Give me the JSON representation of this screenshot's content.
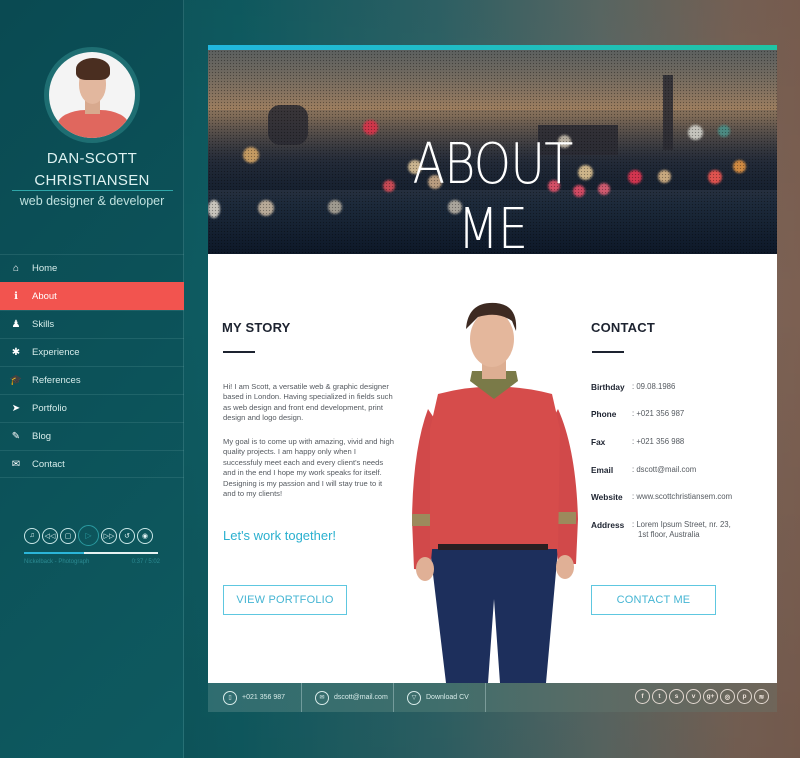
{
  "profile": {
    "name_line1": "DAN-SCOTT",
    "name_line2": "CHRISTIANSEN",
    "role": "web designer & developer"
  },
  "sidebar": {
    "items": [
      {
        "label": "Home",
        "icon": "home-icon",
        "glyph": "⌂",
        "active": false
      },
      {
        "label": "About",
        "icon": "info-icon",
        "glyph": "ℹ",
        "active": true
      },
      {
        "label": "Skills",
        "icon": "user-check-icon",
        "glyph": "♟",
        "active": false
      },
      {
        "label": "Experience",
        "icon": "gear-icon",
        "glyph": "✱",
        "active": false
      },
      {
        "label": "References",
        "icon": "graduation-cap-icon",
        "glyph": "🎓",
        "active": false
      },
      {
        "label": "Portfolio",
        "icon": "paper-plane-icon",
        "glyph": "➤",
        "active": false
      },
      {
        "label": "Blog",
        "icon": "quill-icon",
        "glyph": "✎",
        "active": false
      },
      {
        "label": "Contact",
        "icon": "envelope-icon",
        "glyph": "✉",
        "active": false
      }
    ]
  },
  "player": {
    "controls": [
      {
        "name": "music-icon",
        "glyph": "♫"
      },
      {
        "name": "rewind-icon",
        "glyph": "◁◁"
      },
      {
        "name": "stop-icon",
        "glyph": "▢"
      },
      {
        "name": "play-icon",
        "glyph": "▷"
      },
      {
        "name": "forward-icon",
        "glyph": "▷▷"
      },
      {
        "name": "repeat-icon",
        "glyph": "↺"
      },
      {
        "name": "volume-icon",
        "glyph": "◉"
      }
    ],
    "track": "Nickelback - Photograph",
    "time": "0:37 / 5:02",
    "progress": 0.45
  },
  "hero": {
    "title": "ABOUT ME"
  },
  "story": {
    "title": "MY STORY",
    "paragraph1": "Hi! I am Scott, a versatile web & graphic designer based in London. Having specialized in fields such as web design and front end development, print design and logo design.",
    "paragraph2": "My goal is to come up with amazing, vivid and high quality projects. I am happy only  when I successfuly meet each and every client's needs and in the end I hope my work speaks for itself. Designing is my passion and I will stay true to it and to my clients!",
    "tagline": "Let's work together!",
    "button": "VIEW PORTFOLIO"
  },
  "contact": {
    "title": "CONTACT",
    "rows": [
      {
        "key": "Birthday",
        "value": ": 09.08.1986"
      },
      {
        "key": "Phone",
        "value": ": +021 356 987"
      },
      {
        "key": "Fax",
        "value": ": +021 356 988"
      },
      {
        "key": "Email",
        "value": ": dscott@mail.com"
      },
      {
        "key": "Website",
        "value": ": www.scottchristiansem.com"
      },
      {
        "key": "Address",
        "value": ": Lorem Ipsum Street, nr. 23,",
        "value2": "1st floor, Australia"
      }
    ],
    "button": "CONTACT ME"
  },
  "footer": {
    "phone": "+021 356 987",
    "email": "dscott@mail.com",
    "download": "Download CV",
    "social": [
      {
        "name": "facebook-icon",
        "glyph": "f"
      },
      {
        "name": "twitter-icon",
        "glyph": "t"
      },
      {
        "name": "skype-icon",
        "glyph": "s"
      },
      {
        "name": "vimeo-icon",
        "glyph": "v"
      },
      {
        "name": "google-plus-icon",
        "glyph": "g+"
      },
      {
        "name": "dribbble-icon",
        "glyph": "◎"
      },
      {
        "name": "pinterest-icon",
        "glyph": "p"
      },
      {
        "name": "rss-icon",
        "glyph": "≋"
      }
    ]
  },
  "colors": {
    "accent_red": "#f2544f",
    "accent_cyan": "#2ab0cf",
    "sidebar_bg": "#0c5259",
    "heading": "#1d2330"
  }
}
